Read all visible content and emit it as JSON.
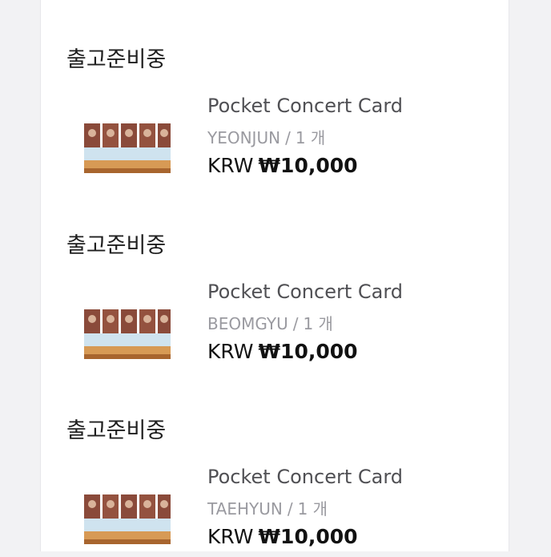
{
  "orders": [
    {
      "status": "출고준비중",
      "product_name": "Pocket Concert Card",
      "member": "YEONJUN",
      "quantity": "1 개",
      "currency": "KRW",
      "amount": "₩10,000"
    },
    {
      "status": "출고준비중",
      "product_name": "Pocket Concert Card",
      "member": "BEOMGYU",
      "quantity": "1 개",
      "currency": "KRW",
      "amount": "₩10,000"
    },
    {
      "status": "출고준비중",
      "product_name": "Pocket Concert Card",
      "member": "TAEHYUN",
      "quantity": "1 개",
      "currency": "KRW",
      "amount": "₩10,000"
    }
  ],
  "colors": {
    "page_background": "#f2f2f4",
    "card_background": "#ffffff",
    "status_text": "#1f1f1f",
    "product_name_text": "#505054",
    "option_text": "#9a9aa0",
    "price_text": "#111111"
  }
}
